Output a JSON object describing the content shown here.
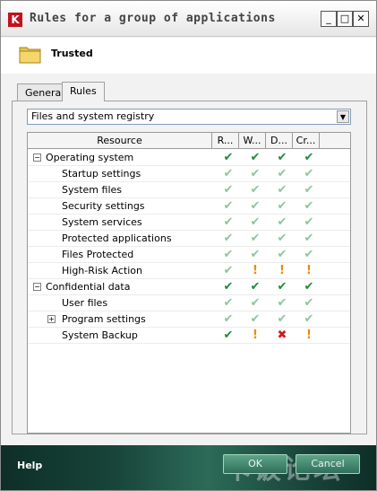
{
  "window": {
    "title": "Rules for a group of applications",
    "logo_letter": "K",
    "minimize_glyph": "_",
    "maximize_glyph": "□",
    "close_glyph": "✕"
  },
  "header": {
    "title": "Trusted",
    "icon": "folder-icon"
  },
  "tabs": [
    {
      "label": "General",
      "active": false
    },
    {
      "label": "Rules",
      "active": true
    }
  ],
  "category_select": {
    "value": "Files and system registry"
  },
  "table": {
    "columns": [
      "Resource",
      "R...",
      "W...",
      "D...",
      "Cr..."
    ],
    "rows": [
      {
        "label": "Operating system",
        "level": 0,
        "expander": "−",
        "marks": [
          "ok",
          "ok",
          "ok",
          "ok"
        ]
      },
      {
        "label": "Startup settings",
        "level": 1,
        "expander": "",
        "marks": [
          "lite",
          "lite",
          "lite",
          "lite"
        ]
      },
      {
        "label": "System files",
        "level": 1,
        "expander": "",
        "marks": [
          "lite",
          "lite",
          "lite",
          "lite"
        ]
      },
      {
        "label": "Security settings",
        "level": 1,
        "expander": "",
        "marks": [
          "lite",
          "lite",
          "lite",
          "lite"
        ]
      },
      {
        "label": "System services",
        "level": 1,
        "expander": "",
        "marks": [
          "lite",
          "lite",
          "lite",
          "lite"
        ]
      },
      {
        "label": "Protected applications",
        "level": 1,
        "expander": "",
        "marks": [
          "lite",
          "lite",
          "lite",
          "lite"
        ]
      },
      {
        "label": "Files Protected",
        "level": 1,
        "expander": "",
        "marks": [
          "lite",
          "lite",
          "lite",
          "lite"
        ]
      },
      {
        "label": "High-Risk Action",
        "level": 1,
        "expander": "",
        "marks": [
          "lite",
          "warn",
          "warn",
          "warn"
        ]
      },
      {
        "label": "Confidential data",
        "level": 0,
        "expander": "−",
        "marks": [
          "ok",
          "ok",
          "ok",
          "ok"
        ]
      },
      {
        "label": "User files",
        "level": 1,
        "expander": "",
        "marks": [
          "lite",
          "lite",
          "lite",
          "lite"
        ]
      },
      {
        "label": "Program settings",
        "level": 1,
        "expander": "+",
        "marks": [
          "lite",
          "lite",
          "lite",
          "lite"
        ]
      },
      {
        "label": "System Backup",
        "level": 1,
        "expander": "",
        "marks": [
          "ok",
          "warn",
          "deny",
          "warn"
        ]
      }
    ],
    "mark_glyphs": {
      "ok": "✔",
      "lite": "✔",
      "warn": "!",
      "deny": "✖"
    }
  },
  "footer": {
    "help_label": "Help",
    "ok_label": "OK",
    "cancel_label": "Cancel",
    "watermark": "卡饭论坛"
  },
  "colors": {
    "allow": "#1e8a3c",
    "allow_inherited": "#8ec5a0",
    "prompt": "#f08a00",
    "deny": "#d21919",
    "brand": "#c0121e"
  }
}
